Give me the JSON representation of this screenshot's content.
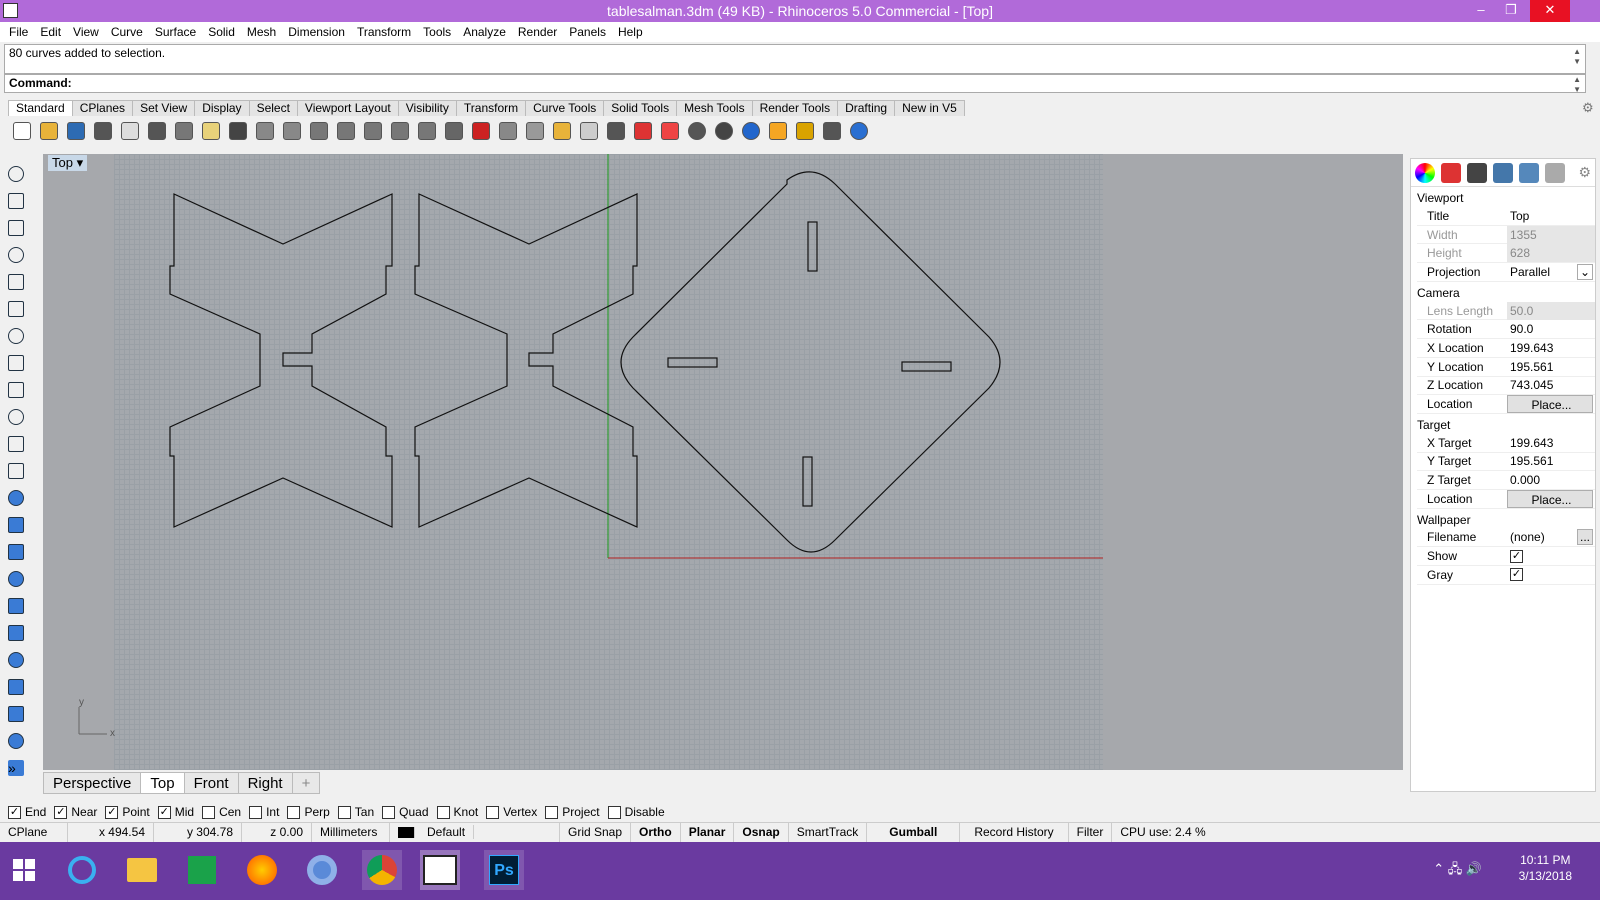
{
  "titlebar": {
    "title": "tablesalman.3dm (49 KB) - Rhinoceros 5.0 Commercial - [Top]",
    "minimize": "–",
    "restore": "❐",
    "close": "✕"
  },
  "menu": [
    "File",
    "Edit",
    "View",
    "Curve",
    "Surface",
    "Solid",
    "Mesh",
    "Dimension",
    "Transform",
    "Tools",
    "Analyze",
    "Render",
    "Panels",
    "Help"
  ],
  "command": {
    "history": "80 curves added to selection.",
    "prompt": "Command:"
  },
  "toolbar_tabs": [
    "Standard",
    "CPlanes",
    "Set View",
    "Display",
    "Select",
    "Viewport Layout",
    "Visibility",
    "Transform",
    "Curve Tools",
    "Solid Tools",
    "Mesh Tools",
    "Render Tools",
    "Drafting",
    "New in V5"
  ],
  "toolbar_icons": [
    "new-file-icon",
    "open-file-icon",
    "save-icon",
    "print-icon",
    "import-icon",
    "cut-icon",
    "copy-icon",
    "paste-icon",
    "undo-icon",
    "pan-icon",
    "rotate-view-icon",
    "zoom-dynamic-icon",
    "zoom-window-icon",
    "zoom-extents-icon",
    "zoom-selected-icon",
    "zoom-target-icon",
    "viewport-layout-icon",
    "car-icon",
    "drafting-icon",
    "circle-icon",
    "snap-icon",
    "light-icon",
    "lock-icon",
    "layer-icon",
    "color-icon",
    "material-icon",
    "render-icon",
    "render-preview-icon",
    "filter-icon",
    "gear-icon",
    "dimension-icon",
    "help-icon"
  ],
  "left_tools": [
    "select-icon",
    "point-icon",
    "polyline-icon",
    "curve-icon",
    "circle-icon",
    "arc-icon",
    "polygon-icon",
    "rectangle-icon",
    "ellipse-icon",
    "fillet-icon",
    "surface-icon",
    "extrude-icon",
    "box-icon",
    "sphere-icon",
    "cylinder-icon",
    "mesh-icon",
    "gear-icon",
    "dimension-icon",
    "transform-icon",
    "analysis-icon",
    "render-icon",
    "group-icon",
    "more-icon"
  ],
  "viewport": {
    "label": "Top",
    "dropdown": "▾",
    "axis_y": "y",
    "axis_x": "x"
  },
  "viewport_tabs": [
    "Perspective",
    "Top",
    "Front",
    "Right",
    "+"
  ],
  "properties": {
    "section_viewport": "Viewport",
    "rows_viewport": [
      {
        "k": "Title",
        "v": "Top"
      },
      {
        "k": "Width",
        "v": "1355"
      },
      {
        "k": "Height",
        "v": "628"
      },
      {
        "k": "Projection",
        "v": "Parallel"
      }
    ],
    "section_camera": "Camera",
    "rows_camera": [
      {
        "k": "Lens Length",
        "v": "50.0"
      },
      {
        "k": "Rotation",
        "v": "90.0"
      },
      {
        "k": "X Location",
        "v": "199.643"
      },
      {
        "k": "Y Location",
        "v": "195.561"
      },
      {
        "k": "Z Location",
        "v": "743.045"
      },
      {
        "k": "Location",
        "v": "Place..."
      }
    ],
    "section_target": "Target",
    "rows_target": [
      {
        "k": "X Target",
        "v": "199.643"
      },
      {
        "k": "Y Target",
        "v": "195.561"
      },
      {
        "k": "Z Target",
        "v": "0.000"
      },
      {
        "k": "Location",
        "v": "Place..."
      }
    ],
    "section_wallpaper": "Wallpaper",
    "rows_wallpaper": [
      {
        "k": "Filename",
        "v": "(none)"
      },
      {
        "k": "Show",
        "v": "✓"
      },
      {
        "k": "Gray",
        "v": "✓"
      }
    ],
    "browse": "..."
  },
  "osnaps": [
    {
      "label": "End",
      "checked": true
    },
    {
      "label": "Near",
      "checked": true
    },
    {
      "label": "Point",
      "checked": true
    },
    {
      "label": "Mid",
      "checked": true
    },
    {
      "label": "Cen",
      "checked": false
    },
    {
      "label": "Int",
      "checked": false
    },
    {
      "label": "Perp",
      "checked": false
    },
    {
      "label": "Tan",
      "checked": false
    },
    {
      "label": "Quad",
      "checked": false
    },
    {
      "label": "Knot",
      "checked": false
    },
    {
      "label": "Vertex",
      "checked": false
    },
    {
      "label": "Project",
      "checked": false
    },
    {
      "label": "Disable",
      "checked": false
    }
  ],
  "status": {
    "cplane": "CPlane",
    "x": "x 494.54",
    "y": "y 304.78",
    "z": "z 0.00",
    "units": "Millimeters",
    "layer": "Default",
    "grid_snap": "Grid Snap",
    "ortho": "Ortho",
    "planar": "Planar",
    "osnap": "Osnap",
    "smarttrack": "SmartTrack",
    "gumball": "Gumball",
    "record_history": "Record History",
    "filter": "Filter",
    "cpu": "CPU use: 2.4 %"
  },
  "taskbar": {
    "time": "10:11 PM",
    "date": "3/13/2018",
    "ps_label": "Ps"
  }
}
